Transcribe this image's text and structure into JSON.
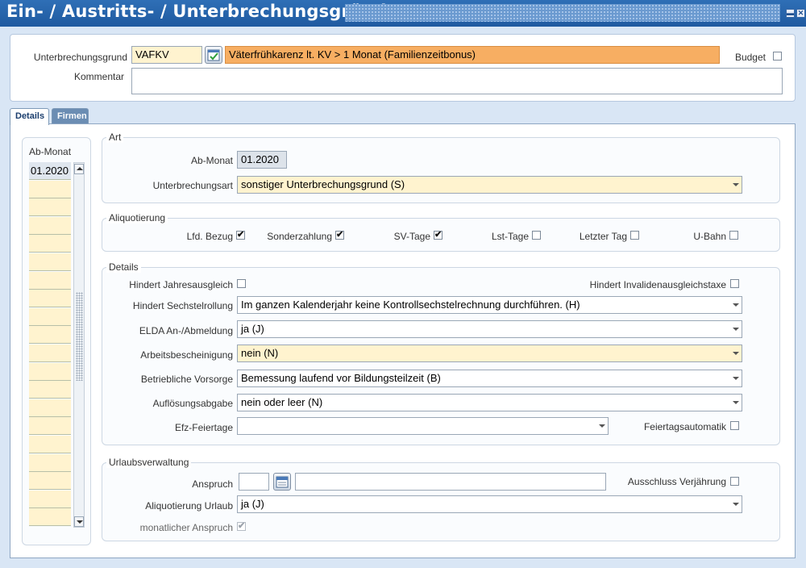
{
  "window": {
    "title": "Ein- / Austritts- / Unterbrechungsgründe",
    "minimize": "▬",
    "close": "✕"
  },
  "header": {
    "unterbrechungsgrund_label": "Unterbrechungsgrund",
    "unterbrechungsgrund_code": "VAFKV",
    "unterbrechungsgrund_text": "Väterfrühkarenz lt. KV > 1 Monat (Familienzeitbonus)",
    "budget_label": "Budget",
    "kommentar_label": "Kommentar",
    "kommentar_value": ""
  },
  "tabs": [
    {
      "label": "Details"
    },
    {
      "label": "Firmen"
    }
  ],
  "month_list": {
    "header": "Ab-Monat",
    "items": [
      "01.2020"
    ]
  },
  "art": {
    "title": "Art",
    "ab_monat_label": "Ab-Monat",
    "ab_monat_value": "01.2020",
    "unterbrechungsart_label": "Unterbrechungsart",
    "unterbrechungsart_value": "sonstiger Unterbrechungsgrund (S)"
  },
  "aliquotierung": {
    "title": "Aliquotierung",
    "items": [
      {
        "label": "Lfd. Bezug",
        "checked": "✔"
      },
      {
        "label": "Sonderzahlung",
        "checked": "✔"
      },
      {
        "label": "SV-Tage",
        "checked": "✔"
      },
      {
        "label": "Lst-Tage",
        "checked": ""
      },
      {
        "label": "Letzter Tag",
        "checked": ""
      },
      {
        "label": "U-Bahn",
        "checked": ""
      }
    ]
  },
  "details": {
    "title": "Details",
    "jahresausgleich_label": "Hindert Jahresausgleich",
    "invalidenausgleichstaxe_label": "Hindert Invalidenausgleichstaxe",
    "sechstelrollung_label": "Hindert Sechstelrollung",
    "sechstelrollung_value": "Im ganzen Kalenderjahr keine Kontrollsechstelrechnung durchführen. (H)",
    "elda_label": "ELDA An-/Abmeldung",
    "elda_value": "ja (J)",
    "arbeitsbescheinigung_label": "Arbeitsbescheinigung",
    "arbeitsbescheinigung_value": "nein (N)",
    "vorsorge_label": "Betriebliche Vorsorge",
    "vorsorge_value": "Bemessung laufend vor Bildungsteilzeit (B)",
    "aufloesungsabgabe_label": "Auflösungsabgabe",
    "aufloesungsabgabe_value": "nein oder leer (N)",
    "efz_feiertage_label": "Efz-Feiertage",
    "efz_feiertage_value": "",
    "feiertagsautomatik_label": "Feiertagsautomatik"
  },
  "urlaub": {
    "title": "Urlaubsverwaltung",
    "anspruch_label": "Anspruch",
    "anspruch_value": "",
    "anspruch_text": "",
    "ausschluss_label": "Ausschluss Verjährung",
    "aliquotierung_label": "Aliquotierung Urlaub",
    "aliquotierung_value": "ja (J)",
    "monatlicher_label": "monatlicher Anspruch",
    "monatlicher_checked": "✔"
  },
  "colors": {
    "title_bar": "#1f5aa0",
    "field_yellow": "#fff3cf",
    "field_orange": "#f7ae62"
  }
}
